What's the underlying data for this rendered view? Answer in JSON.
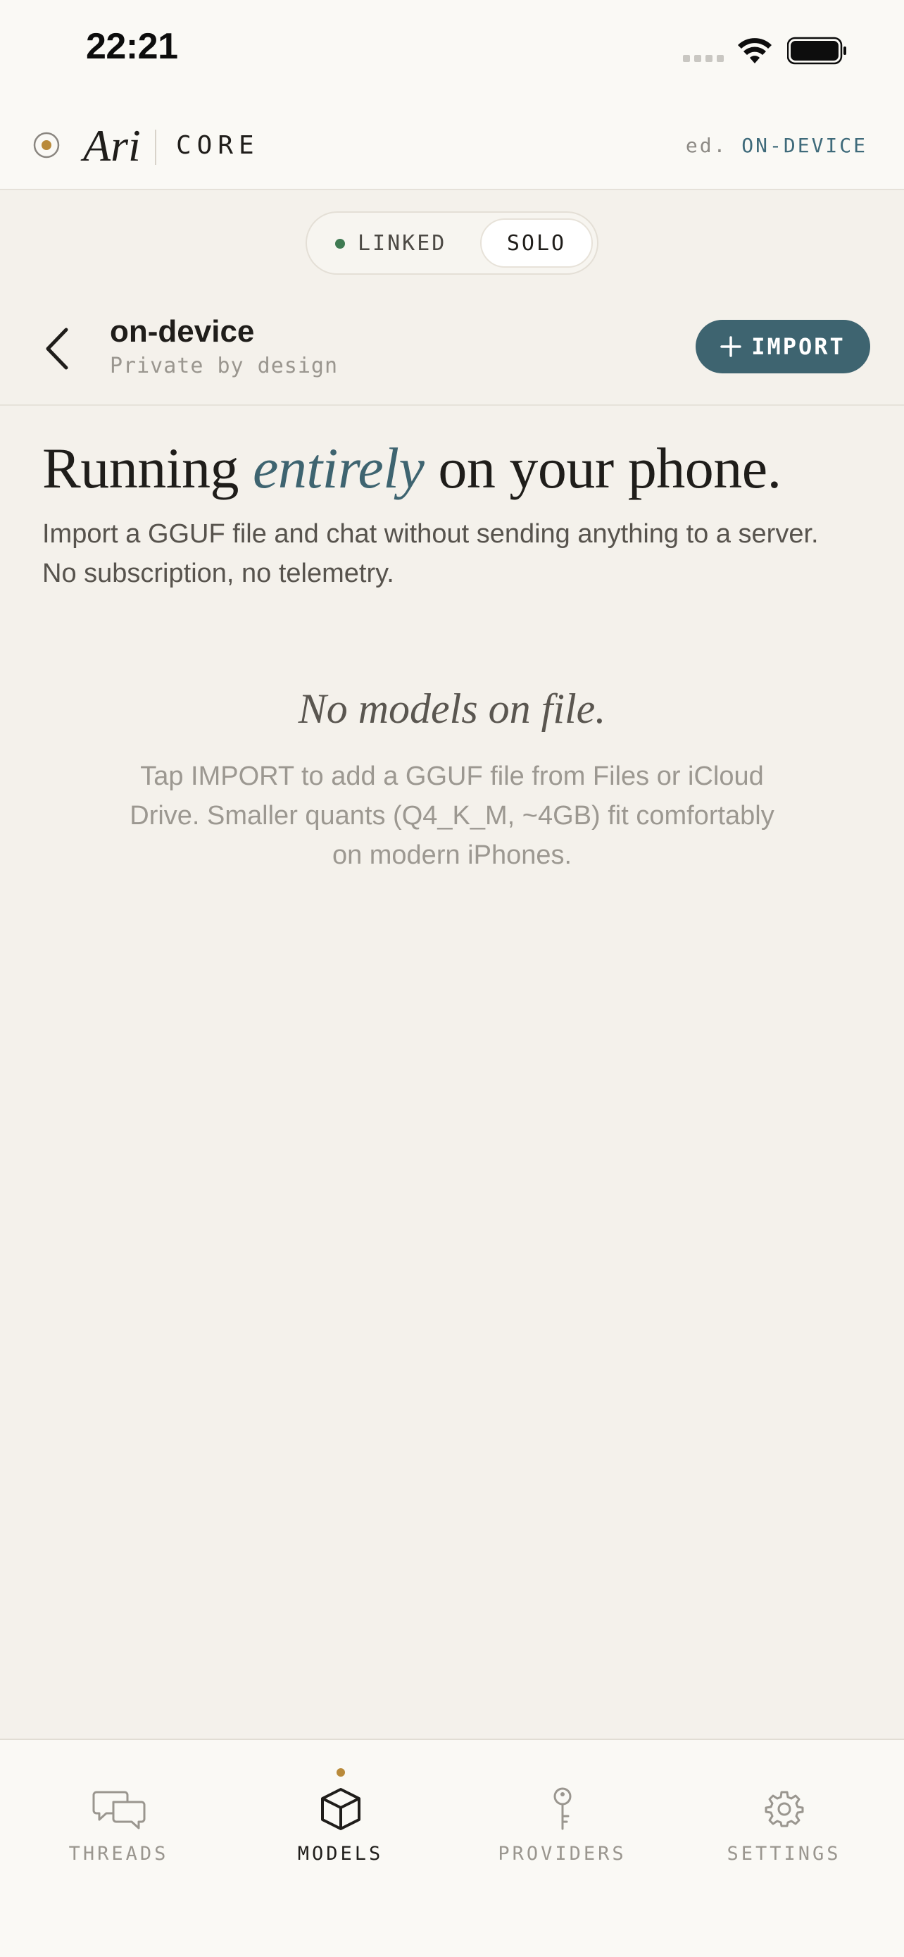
{
  "status_bar": {
    "time": "22:21"
  },
  "header": {
    "brand_name": "Ari",
    "brand_product": "CORE",
    "edition_prefix": "ed.",
    "edition_value": "ON-DEVICE",
    "accent_color": "#b98a3a"
  },
  "mode_toggle": {
    "options": [
      "LINKED",
      "SOLO"
    ],
    "selected": "SOLO",
    "linked_status_color": "#3f7a52"
  },
  "nav": {
    "title": "on-device",
    "subtitle": "Private by design",
    "back_icon": "chevron-left-icon",
    "import_label": "IMPORT",
    "import_icon": "plus-icon",
    "import_color": "#3e6470"
  },
  "hero": {
    "title_before": "Running ",
    "title_emphasis": "entirely",
    "title_after": " on your phone.",
    "body": "Import a GGUF file and chat without sending anything to a server. No subscription, no telemetry."
  },
  "empty_state": {
    "title": "No models on file.",
    "body": "Tap IMPORT to add a GGUF file from Files or iCloud Drive. Smaller quants (Q4_K_M, ~4GB) fit comfortably on modern iPhones."
  },
  "tabs": [
    {
      "label": "THREADS",
      "icon": "chat-bubbles-icon",
      "active": false
    },
    {
      "label": "MODELS",
      "icon": "cube-icon",
      "active": true
    },
    {
      "label": "PROVIDERS",
      "icon": "key-icon",
      "active": false
    },
    {
      "label": "SETTINGS",
      "icon": "gear-icon",
      "active": false
    }
  ]
}
